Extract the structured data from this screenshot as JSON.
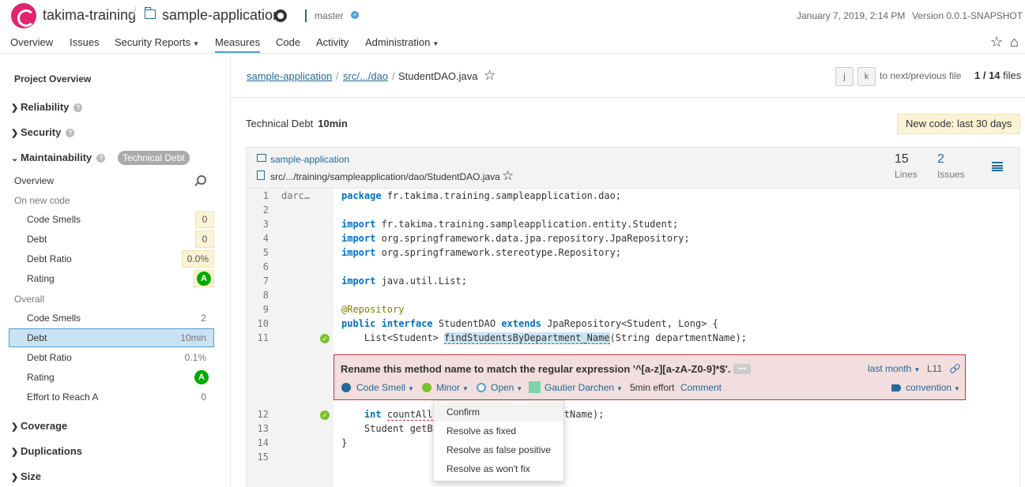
{
  "header": {
    "org": "takima-training",
    "project": "sample-application",
    "branch": "master",
    "branch_add": "+",
    "date": "January 7, 2019, 2:14 PM",
    "version": "Version 0.0.1-SNAPSHOT"
  },
  "nav": {
    "items": [
      "Overview",
      "Issues",
      "Security Reports",
      "Measures",
      "Code",
      "Activity",
      "Administration"
    ],
    "active": "Measures",
    "star": "☆",
    "home": "⌂"
  },
  "sidebar": {
    "title": "Project Overview",
    "domains": [
      "Reliability",
      "Security",
      "Maintainability",
      "Coverage",
      "Duplications",
      "Size"
    ],
    "help": "?",
    "badge": "Technical Debt",
    "overview": "Overview",
    "on_new_code": "On new code",
    "overall": "Overall",
    "new_code_rows": [
      {
        "label": "Code Smells",
        "value": "0"
      },
      {
        "label": "Debt",
        "value": "0"
      },
      {
        "label": "Debt Ratio",
        "value": "0.0%"
      },
      {
        "label": "Rating",
        "value": "A"
      }
    ],
    "overall_rows": [
      {
        "label": "Code Smells",
        "value": "2"
      },
      {
        "label": "Debt",
        "value": "10min"
      },
      {
        "label": "Debt Ratio",
        "value": "0.1%"
      },
      {
        "label": "Rating",
        "value": "A"
      },
      {
        "label": "Effort to Reach A",
        "value": "0"
      }
    ],
    "selected_row": "Debt",
    "rating_color": "#00aa00"
  },
  "breadcrumb": {
    "project": "sample-application",
    "folder": "src/.../dao",
    "file": "StudentDAO.java",
    "sep": "/",
    "star": "☆",
    "key_prev": "j",
    "key_next": "k",
    "hint": "to next/previous file",
    "count": "1 / 14",
    "count_suffix": "files"
  },
  "measure": {
    "label": "Technical Debt",
    "value": "10min",
    "new_code": "New code: last 30 days"
  },
  "viewer": {
    "project": "sample-application",
    "path": "src/.../training/sampleapplication/dao/StudentDAO.java",
    "star": "☆",
    "lines_value": "15",
    "lines_label": "Lines",
    "issues_value": "2",
    "issues_label": "Issues",
    "scm_author": "darc…",
    "issue_marker": "✓",
    "code_lines": [
      "package fr.takima.training.sampleapplication.dao;",
      "",
      "import fr.takima.training.sampleapplication.entity.Student;",
      "import org.springframework.data.jpa.repository.JpaRepository;",
      "import org.springframework.stereotype.Repository;",
      "",
      "import java.util.List;",
      "",
      "@Repository",
      "public interface StudentDAO extends JpaRepository<Student, Long> {",
      "    List<Student> findStudentsByDepartment_Name(String departmentName);",
      "    int countAll…g departmentName);",
      "    Student getB…",
      "}",
      ""
    ]
  },
  "issue": {
    "message": "Rename this method name to match the regular expression '^[a-z][a-zA-Z0-9]*$'.",
    "more": "•••",
    "age": "last month",
    "line": "L11",
    "type": "Code Smell",
    "severity": "Minor",
    "status": "Open",
    "assignee": "Gautier Darchen",
    "effort": "5min effort",
    "comment": "Comment",
    "tag": "convention"
  },
  "dropdown": {
    "items": [
      "Confirm",
      "Resolve as fixed",
      "Resolve as false positive",
      "Resolve as won't fix"
    ],
    "active": "Confirm"
  }
}
